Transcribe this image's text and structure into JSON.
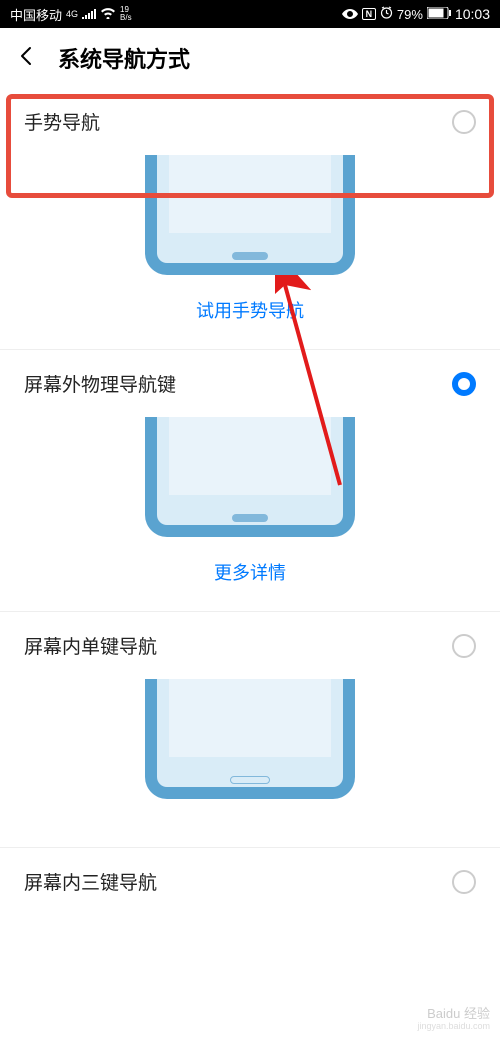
{
  "status": {
    "carrier": "中国移动",
    "netType": "4G",
    "speed": "19",
    "speedUnit": "B/s",
    "battery": "79%",
    "time": "10:03"
  },
  "header": {
    "title": "系统导航方式"
  },
  "options": [
    {
      "label": "手势导航",
      "selected": false,
      "link": "试用手势导航"
    },
    {
      "label": "屏幕外物理导航键",
      "selected": true,
      "link": "更多详情"
    },
    {
      "label": "屏幕内单键导航",
      "selected": false,
      "link": ""
    },
    {
      "label": "屏幕内三键导航",
      "selected": false,
      "link": ""
    }
  ],
  "watermark": {
    "main": "Baidu 经验",
    "sub": "jingyan.baidu.com"
  }
}
